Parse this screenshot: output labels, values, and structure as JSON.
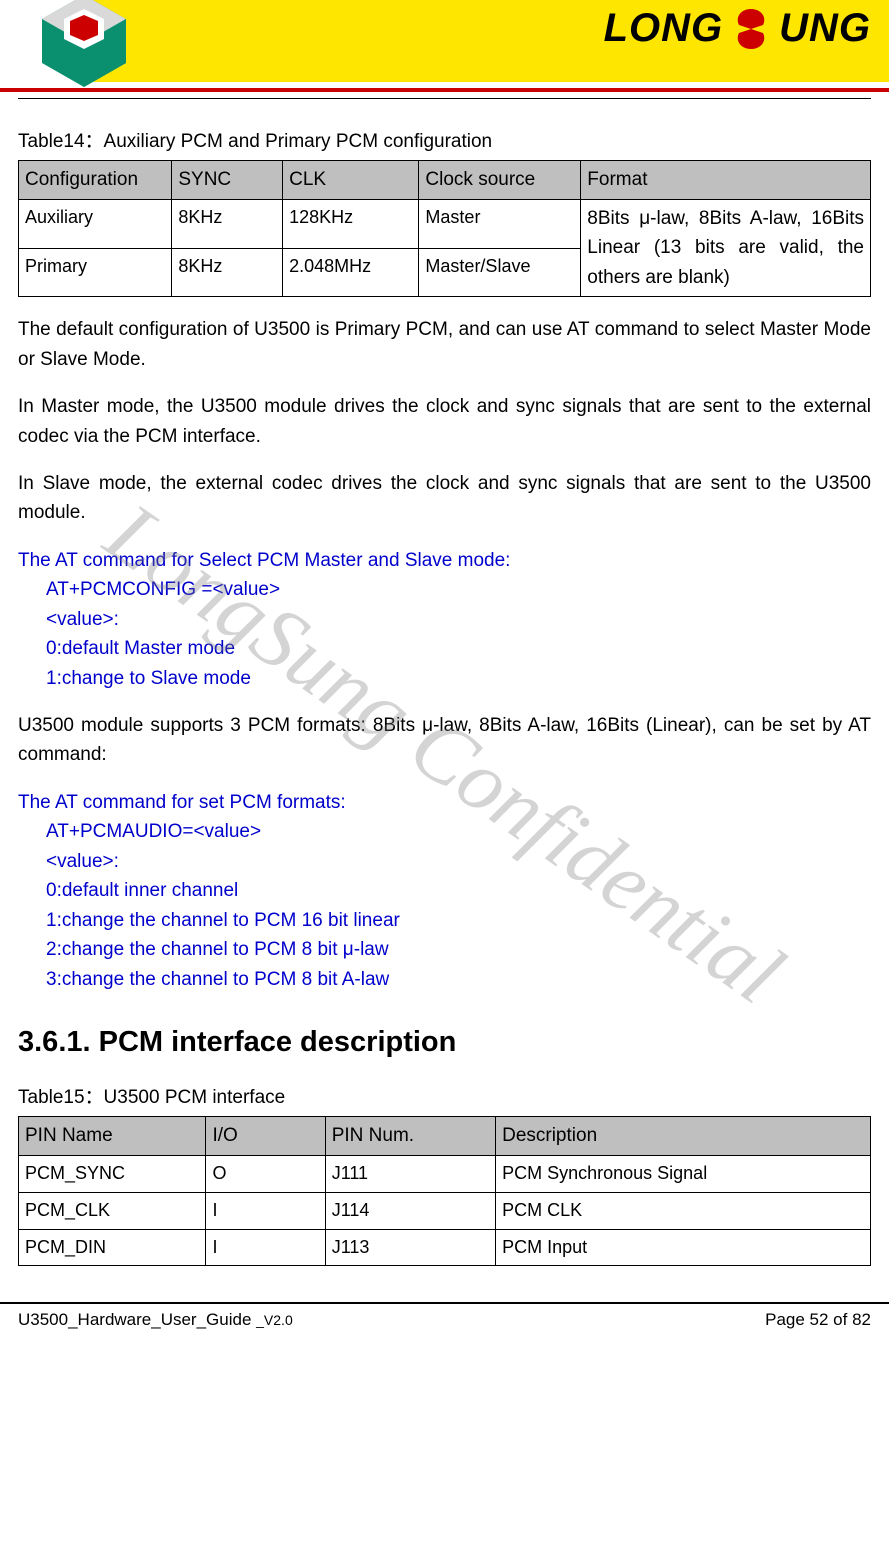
{
  "brand": {
    "left_text": "LONG",
    "right_text": "UNG"
  },
  "watermark": "LongSung Confidential",
  "table1": {
    "caption": "Table14：Auxiliary PCM and Primary PCM configuration",
    "headers": [
      "Configuration",
      "SYNC",
      "CLK",
      "Clock source",
      "Format"
    ],
    "rows": [
      {
        "config": "Auxiliary",
        "sync": "8KHz",
        "clk": "128KHz",
        "src": "Master"
      },
      {
        "config": "Primary",
        "sync": "8KHz",
        "clk": "2.048MHz",
        "src": "Master/Slave"
      }
    ],
    "format_merged": "8Bits μ-law, 8Bits A-law, 16Bits Linear (13 bits are valid, the others are blank)"
  },
  "paras": {
    "p1": "The default configuration of U3500 is Primary PCM, and can use AT command to select Master Mode or Slave Mode.",
    "p2": "In Master mode, the U3500 module drives the clock and sync signals that are sent to the external codec via the PCM interface.",
    "p3": "In Slave mode, the external codec drives the clock and sync signals that are sent to the U3500 module.",
    "p4": "U3500 module supports 3 PCM formats: 8Bits μ-law, 8Bits A-law, 16Bits (Linear), can be set by AT command:"
  },
  "blue1": {
    "title": "The AT command for Select PCM Master and Slave mode:",
    "l1": "AT+PCMCONFIG =<value>",
    "l2": "<value>:",
    "l3": "0:default Master mode",
    "l4": "1:change to Slave mode"
  },
  "blue2": {
    "title": "The AT command for set PCM formats:",
    "l1": "AT+PCMAUDIO=<value>",
    "l2": "<value>:",
    "l3": "0:default inner channel",
    "l4": "1:change the channel to PCM 16 bit linear",
    "l5": "2:change the channel to PCM 8 bit μ-law",
    "l6": "3:change the channel to PCM 8 bit A-law"
  },
  "section_heading": "3.6.1. PCM interface description",
  "table2": {
    "caption": "Table15：U3500 PCM interface",
    "headers": [
      "PIN Name",
      "I/O",
      "PIN Num.",
      "Description"
    ],
    "rows": [
      {
        "c0": "PCM_SYNC",
        "c1": "O",
        "c2": "J111",
        "c3": "PCM Synchronous Signal"
      },
      {
        "c0": "PCM_CLK",
        "c1": "I",
        "c2": "J114",
        "c3": "PCM CLK"
      },
      {
        "c0": "PCM_DIN",
        "c1": "I",
        "c2": "J113",
        "c3": "PCM Input"
      }
    ]
  },
  "footer": {
    "doc": "U3500_Hardware_User_Guide ",
    "ver": "_V2.0",
    "page": "Page 52 of 82"
  }
}
